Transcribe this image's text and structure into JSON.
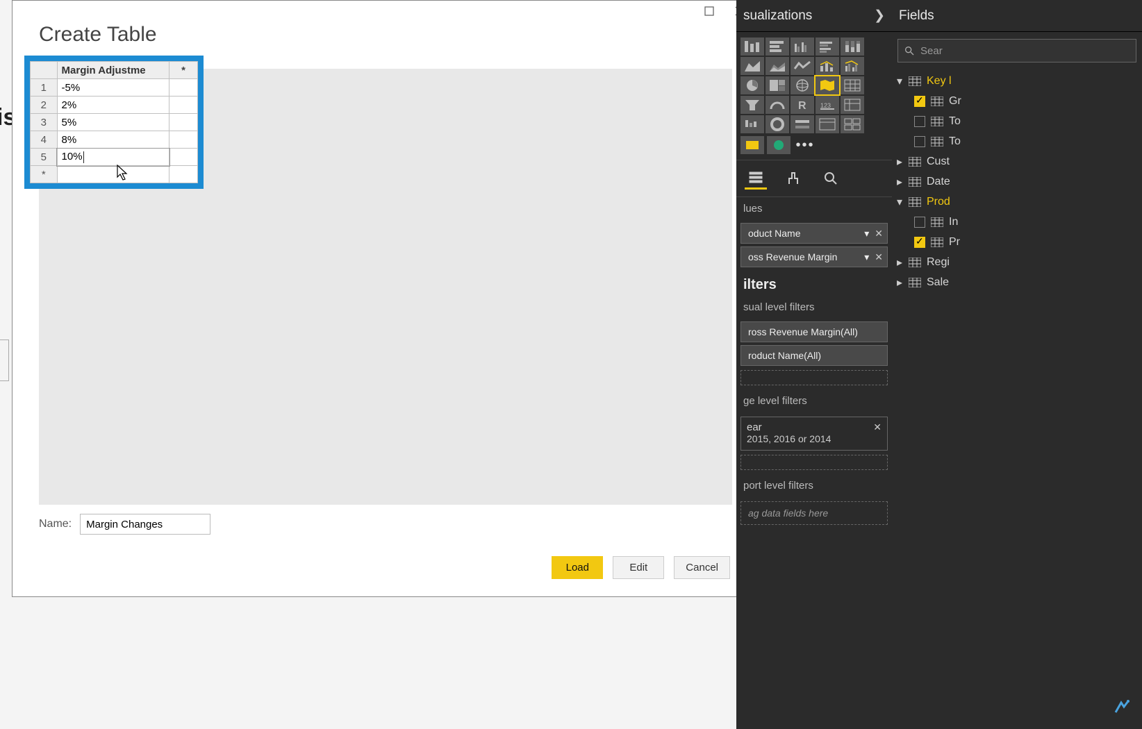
{
  "dialog": {
    "title": "Create Table",
    "column_header": "Margin Adjustme",
    "rows": [
      {
        "n": "1",
        "v": "-5%"
      },
      {
        "n": "2",
        "v": "2%"
      },
      {
        "n": "3",
        "v": "5%"
      },
      {
        "n": "4",
        "v": "8%"
      },
      {
        "n": "5",
        "v": "10%"
      }
    ],
    "new_marker": "*",
    "name_label": "Name:",
    "name_value": "Margin Changes",
    "btn_load": "Load",
    "btn_edit": "Edit",
    "btn_cancel": "Cancel"
  },
  "viz": {
    "title": "sualizations",
    "tool_values_label": "lues",
    "field1": "oduct Name",
    "field2": "oss Revenue Margin",
    "filters_head": "ilters",
    "visual_filters": "sual level filters",
    "vf1": "ross Revenue Margin(All)",
    "vf2": "roduct Name(All)",
    "page_filters": "ge level filters",
    "pf_title": "ear",
    "pf_value": "2015, 2016 or 2014",
    "report_filters": "port level filters",
    "drag_hint": "ag data fields here"
  },
  "fields": {
    "title": "Fields",
    "search_placeholder": "Sear",
    "tables": [
      {
        "name": "Key l",
        "expanded": true,
        "yellow": true,
        "children": [
          {
            "name": "Gr",
            "checked": true
          },
          {
            "name": "To",
            "checked": false
          },
          {
            "name": "To",
            "checked": false
          }
        ]
      },
      {
        "name": "Cust",
        "expanded": false
      },
      {
        "name": "Date",
        "expanded": false
      },
      {
        "name": "Prod",
        "expanded": true,
        "yellow": true,
        "children": [
          {
            "name": "In",
            "checked": false
          },
          {
            "name": "Pr",
            "checked": true
          }
        ]
      },
      {
        "name": "Regi",
        "expanded": false
      },
      {
        "name": "Sale",
        "expanded": false
      }
    ]
  }
}
